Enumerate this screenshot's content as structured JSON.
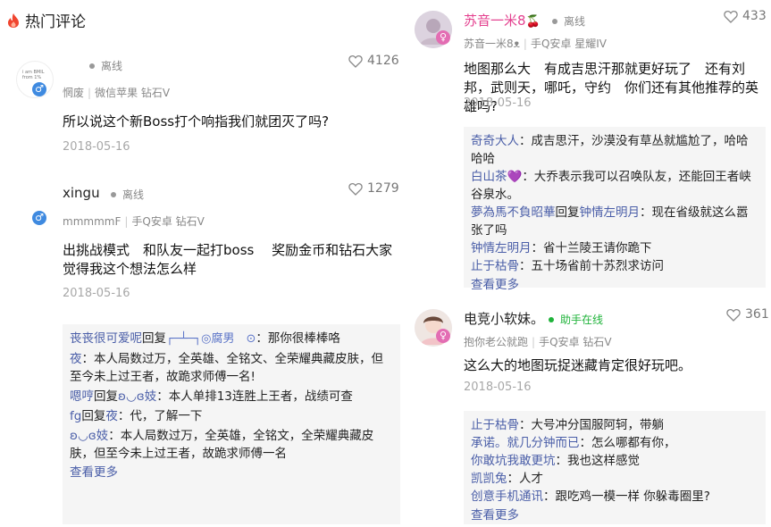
{
  "section": {
    "title": "热门评论",
    "icon": "flame-icon",
    "icon_color": "#f0452f"
  },
  "colors": {
    "link": "#4a5ea8",
    "date": "#a8a8a8",
    "pink_name": "#e4418f",
    "online_green": "#1fb33a",
    "reply_bg": "#f5f5f5"
  },
  "left": {
    "c1": {
      "avatar_text": "i am BMIL from 1%",
      "status": "离线",
      "likes": "4126",
      "meta_user": "惘废",
      "meta_device": "微信苹果 钻石V",
      "text": "所以说这个新Boss打个响指我们就团灭了吗?",
      "date": "2018-05-16"
    },
    "c2": {
      "name": "xingu",
      "status": "离线",
      "likes": "1279",
      "meta_user": "mmmmmF",
      "meta_device": "手Q安卓 钻石V",
      "text": "出挑战模式　和队友一起打boss　 奖励金币和钻石大家觉得我这个想法怎么样",
      "date": "2018-05-16",
      "replies": {
        "r1_name": "丧丧很可爱呢",
        "r1_verb": "回复",
        "r1_target": "┌─┴─┐◎腐男　⊙",
        "r1_text": "：那你很棒棒咯",
        "r2_name": "夜",
        "r2_text": "：本人局数过万，全英雄、全铭文、全荣耀典藏皮肤，但至今未上过王者，故跪求师傅一名!",
        "r3_name": "嗯哼",
        "r3_verb": "回复",
        "r3_target": "ʚ◡ɞ妓",
        "r3_text": "：本人单排13连胜上王者，战绩可查",
        "r4_name": "fg",
        "r4_verb": "回复",
        "r4_target": "夜",
        "r4_text": "：代，了解一下",
        "r5_name": "ʚ◡ɞ妓",
        "r5_text": "：本人局数过万，全英雄，全铭文，全荣耀典藏皮肤，但至今未上过王者，故跪求师傅一名",
        "more": "查看更多"
      }
    }
  },
  "right": {
    "c3": {
      "name": "苏音一米8",
      "name_suffix": "🍒",
      "status": "离线",
      "likes": "433",
      "meta_user": "苏音一米8ᴥ",
      "meta_device": "手Q安卓 星耀IV",
      "text": "地图那么大　有成吉思汗那就更好玩了　还有刘邦，武则天，哪吒，守约　你们还有其他推荐的英雄吗?",
      "date": "2018-05-16",
      "replies": {
        "r1_name": "奇奇大人",
        "r1_text": "：成吉思汗，沙漠没有草丛就尴尬了，哈哈哈哈",
        "r2_name": "白山茶",
        "r2_heart": "💜",
        "r2_text": "：大乔表示我可以召唤队友，还能回王者峡谷泉水。",
        "r3_name": "夢為馬不負昭華",
        "r3_verb": "回复",
        "r3_target": "钟情左明月",
        "r3_text": "：现在省级就这么嚣张了吗",
        "r4_name": "钟情左明月",
        "r4_text": "：省十兰陵王请你跪下",
        "r5_name": "止于枯骨",
        "r5_text": "：五十场省前十苏烈求访问",
        "more": "查看更多"
      }
    },
    "c4": {
      "name": "电竞小软妹。",
      "status": "助手在线",
      "likes": "361",
      "meta_user": "抱你老公就跑",
      "meta_device": "手Q安卓 钻石V",
      "text": "这么大的地图玩捉迷藏肯定很好玩吧。",
      "date": "2018-05-16",
      "replies": {
        "r1_name": "止于枯骨",
        "r1_text": "：大号冲分国服阿轲，带躺",
        "r2_name": "承诺。就几分钟而已",
        "r2_text": "：怎么哪都有你，",
        "r3_name": "你敢坑我敢更坑",
        "r3_text": "：我也这样感觉",
        "r4_name": "凯凯兔",
        "r4_text": "：人才",
        "r5_name": "创意手机通讯",
        "r5_text": "：跟吃鸡一模一样 你躲毒圈里?",
        "more": "查看更多"
      }
    }
  }
}
